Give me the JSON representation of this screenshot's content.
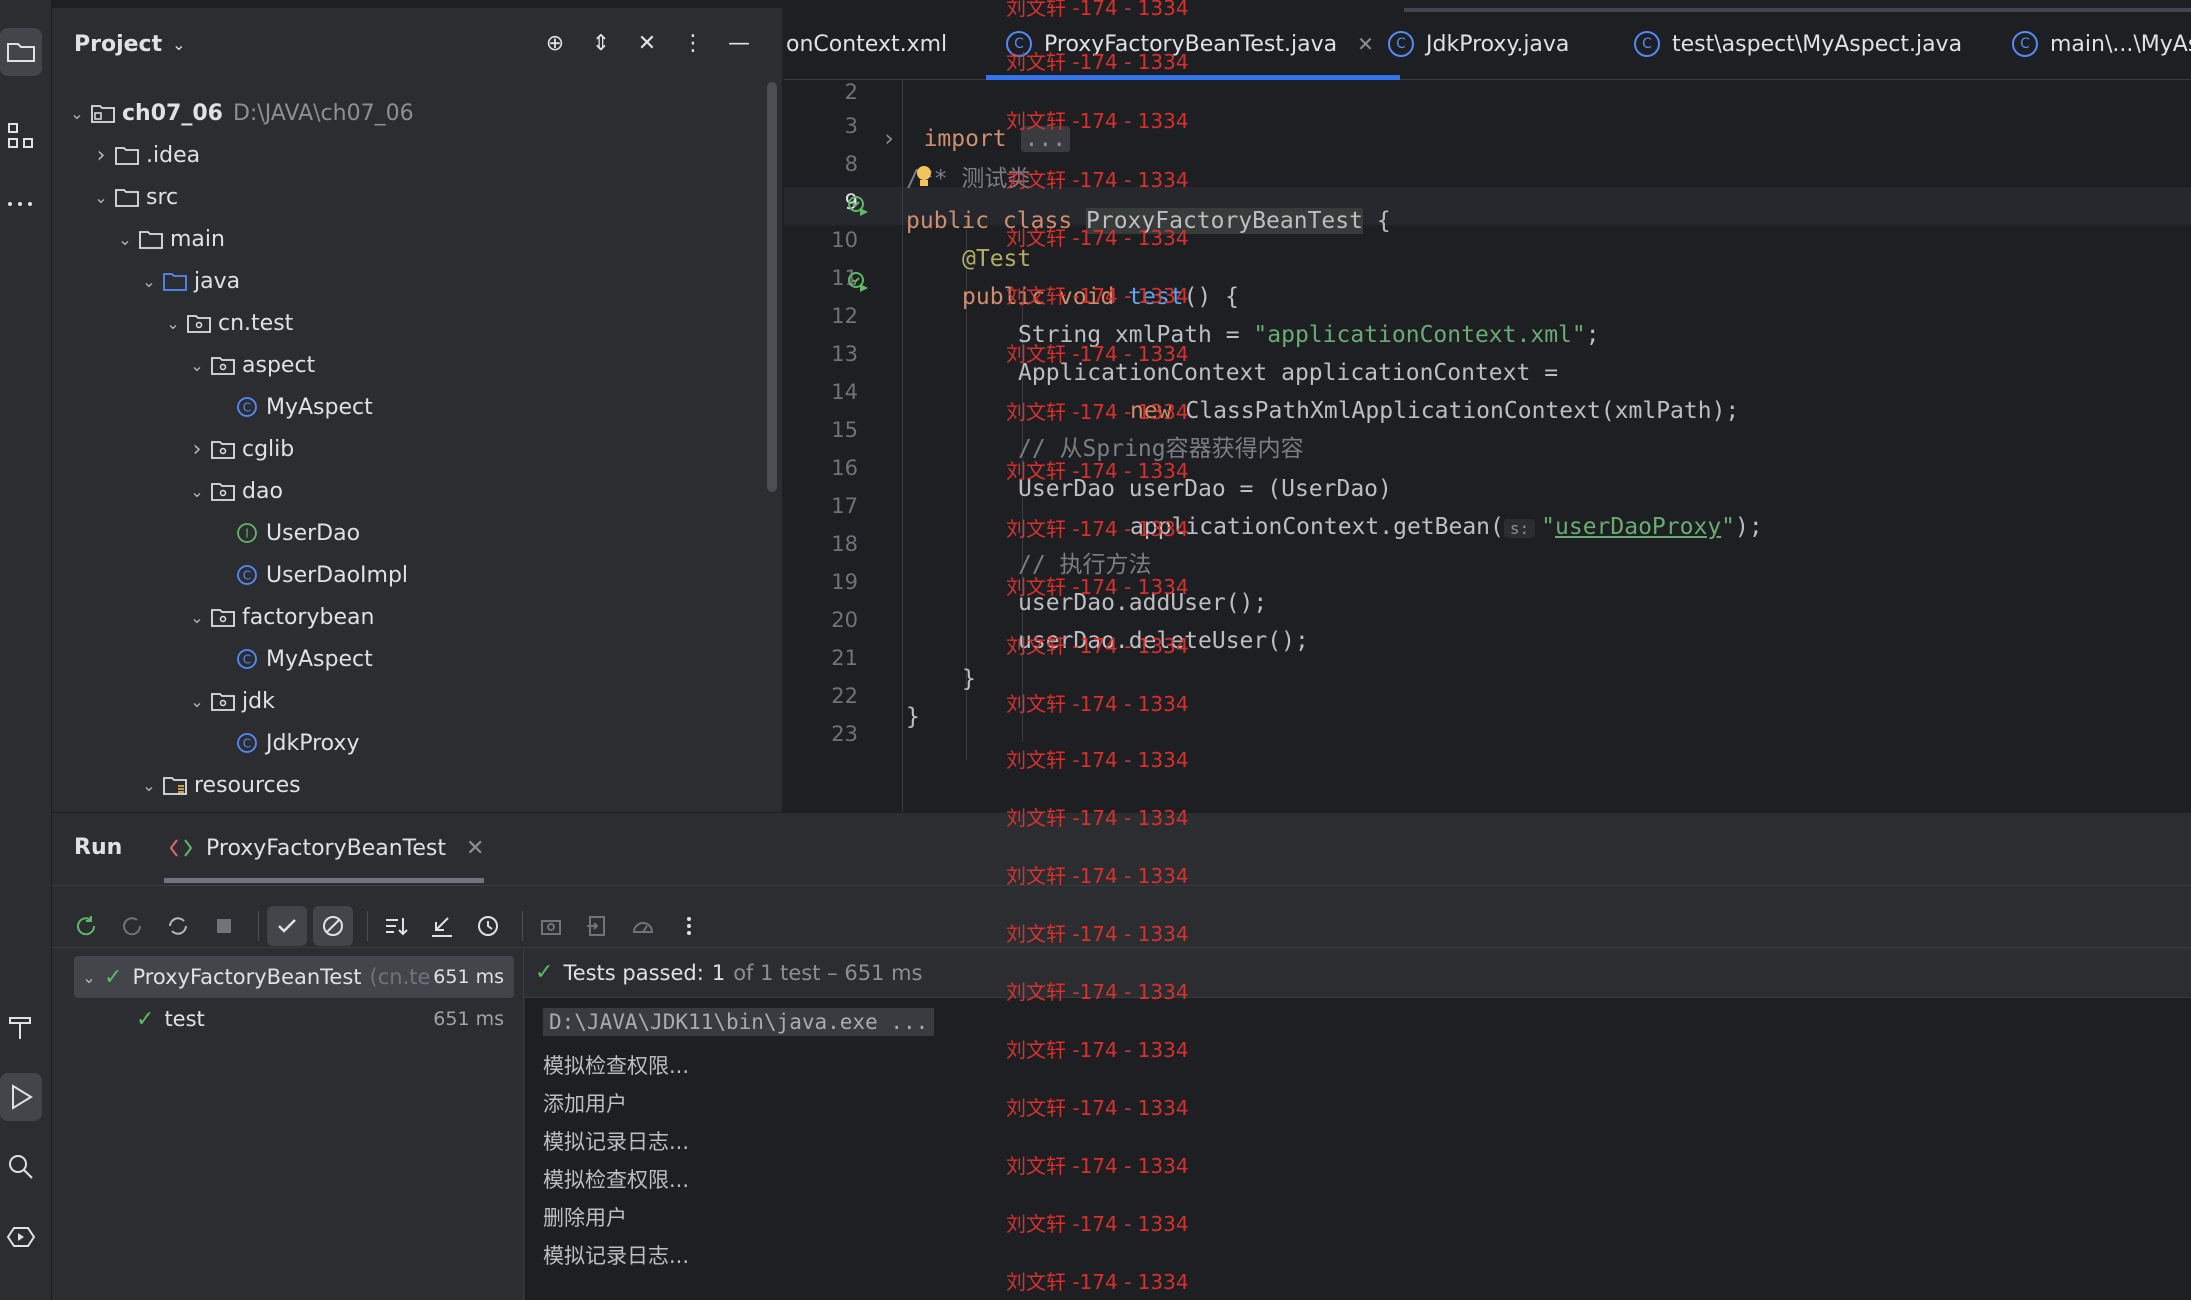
{
  "project_panel": {
    "title": "Project",
    "tree": [
      {
        "label": "ch07_06",
        "hint": "D:\\JAVA\\ch07_06",
        "expanded": true,
        "kind": "module"
      },
      {
        "label": ".idea",
        "expanded": false,
        "kind": "folder"
      },
      {
        "label": "src",
        "expanded": true,
        "kind": "folder"
      },
      {
        "label": "main",
        "expanded": true,
        "kind": "folder"
      },
      {
        "label": "java",
        "expanded": true,
        "kind": "source-folder"
      },
      {
        "label": "cn.test",
        "expanded": true,
        "kind": "package"
      },
      {
        "label": "aspect",
        "expanded": true,
        "kind": "package"
      },
      {
        "label": "MyAspect",
        "kind": "class"
      },
      {
        "label": "cglib",
        "expanded": false,
        "kind": "package"
      },
      {
        "label": "dao",
        "expanded": true,
        "kind": "package"
      },
      {
        "label": "UserDao",
        "kind": "interface"
      },
      {
        "label": "UserDaoImpl",
        "kind": "class"
      },
      {
        "label": "factorybean",
        "expanded": true,
        "kind": "package"
      },
      {
        "label": "MyAspect",
        "kind": "class"
      },
      {
        "label": "jdk",
        "expanded": true,
        "kind": "package"
      },
      {
        "label": "JdkProxy",
        "kind": "class"
      },
      {
        "label": "resources",
        "expanded": true,
        "kind": "resource-folder"
      }
    ]
  },
  "editor": {
    "tabs": [
      {
        "label": "onContext.xml",
        "active": false
      },
      {
        "label": "ProxyFactoryBeanTest.java",
        "active": true
      },
      {
        "label": "JdkProxy.java",
        "active": false
      },
      {
        "label": "test\\aspect\\MyAspect.java",
        "active": false
      },
      {
        "label": "main\\...\\MyAs",
        "active": false
      }
    ],
    "line_numbers": [
      "2",
      "3",
      "8",
      "9",
      "10",
      "11",
      "12",
      "13",
      "14",
      "15",
      "16",
      "17",
      "18",
      "19",
      "20",
      "21",
      "22",
      "23"
    ],
    "current_line": "9",
    "code": {
      "l3_kw": "import",
      "l3_fold": "...",
      "l8_comment": "/** 测试类",
      "l9_kw": "public class ",
      "l9_cls": "ProxyFactoryBeanTest",
      "l9_rest": " {",
      "l10_ann": "@Test",
      "l11_kw": "public void ",
      "l11_fn": "test",
      "l11_rest": "() {",
      "l12_a": "String xmlPath = ",
      "l12_str": "\"applicationContext.xml\"",
      "l12_b": ";",
      "l13": "ApplicationContext applicationContext =",
      "l14_kw": "new ",
      "l14_rest": "ClassPathXmlApplicationContext(xmlPath);",
      "l15_cmt": "// 从Spring容器获得内容",
      "l16": "UserDao userDao = (UserDao)",
      "l17_a": "applicationContext.getBean(",
      "l17_hint": "s:",
      "l17_q1": "\"",
      "l17_link": "userDaoProxy",
      "l17_q2": "\"",
      "l17_b": ");",
      "l18_cmt": "// 执行方法",
      "l19": "userDao.addUser();",
      "l20": "userDao.deleteUser();",
      "l21": "}",
      "l22": "}"
    }
  },
  "run_panel": {
    "title": "Run",
    "tab_label": "ProxyFactoryBeanTest",
    "test_tree": [
      {
        "label": "ProxyFactoryBeanTest",
        "pkg": "(cn.te",
        "time": "651 ms",
        "status": "passed"
      },
      {
        "label": "test",
        "time": "651 ms",
        "status": "passed"
      }
    ],
    "status": {
      "passed_prefix": "Tests passed:",
      "passed_count": "1",
      "detail": "of 1 test – 651 ms"
    },
    "console": [
      "D:\\JAVA\\JDK11\\bin\\java.exe ...",
      "模拟检查权限...",
      "添加用户",
      "模拟记录日志...",
      "模拟检查权限...",
      "删除用户",
      "模拟记录日志..."
    ]
  },
  "watermark": "刘文轩 -174 - 1334",
  "colors": {
    "accent": "#3574f0",
    "pass": "#5fb865",
    "watermark": "#e0332e"
  }
}
